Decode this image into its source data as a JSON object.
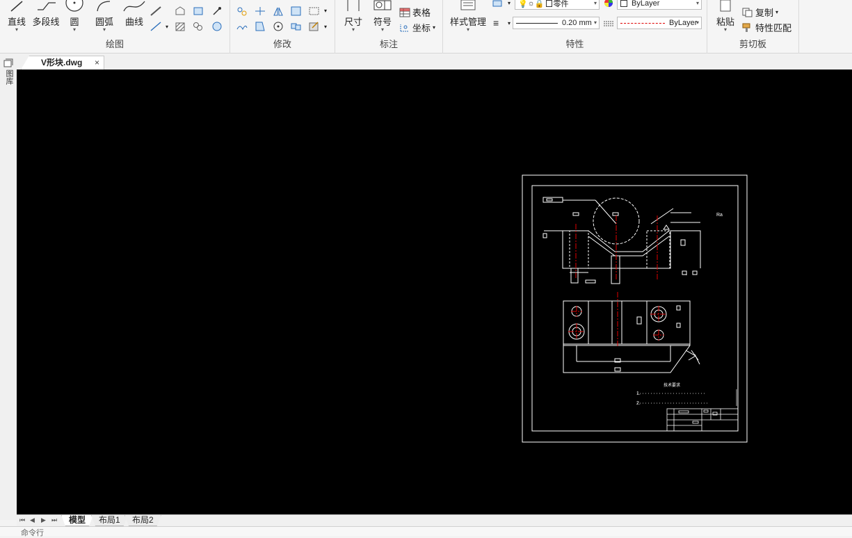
{
  "ribbon": {
    "draw": {
      "title": "绘图",
      "line": "直线",
      "polyline": "多段线",
      "circle": "圆",
      "arc": "圆弧",
      "curve": "曲线"
    },
    "modify": {
      "title": "修改"
    },
    "annotate": {
      "title": "标注",
      "dimension": "尺寸",
      "symbol": "符号",
      "table": "表格",
      "coordinate": "坐标"
    },
    "properties": {
      "title": "特性",
      "style_manager": "样式管理",
      "layer_name": "零件",
      "color_value": "ByLayer",
      "lineweight_value": "0.20 mm",
      "linetype_value": "ByLayer"
    },
    "clipboard": {
      "title": "剪切板",
      "paste": "粘贴",
      "copy": "复制",
      "match_properties": "特性匹配"
    }
  },
  "document_tab": {
    "name": "V形块.dwg",
    "close": "×"
  },
  "left_bar": {
    "label": "图库"
  },
  "layout_tabs": [
    "模型",
    "布局1",
    "布局2"
  ],
  "nav_arrows": [
    "⏮",
    "◀",
    "▶",
    "⏭"
  ],
  "command_line": {
    "prompt": "命令行"
  },
  "drawing": {
    "tech_req_title": "技术要求",
    "roughness_note": "Ra"
  },
  "colors": {
    "canvas": "#000000",
    "drawing_line": "#ffffff",
    "center_line": "#e00000"
  }
}
